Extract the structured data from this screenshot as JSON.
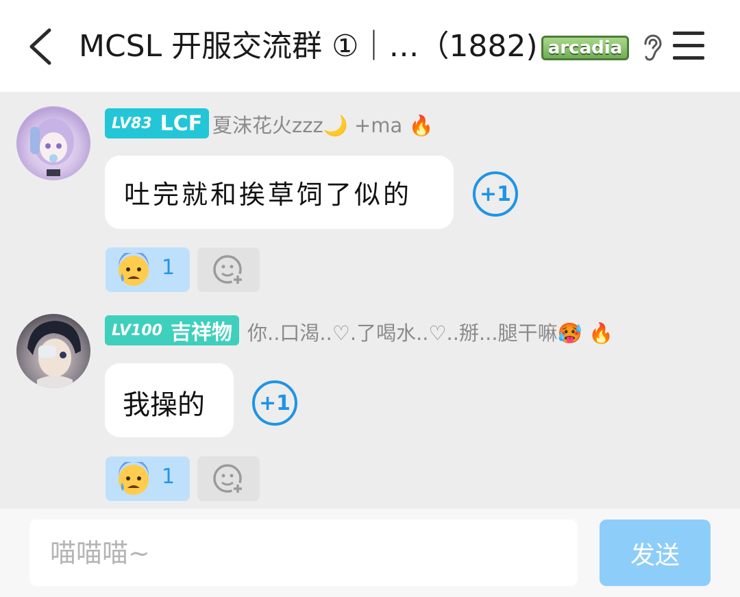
{
  "header": {
    "title": "MCSL 开服交流群 ①｜…（1882)",
    "badge_text": "arcadia",
    "back_icon": "back-chevron-icon",
    "ear_icon": "ear-icon",
    "menu_icon": "menu-icon"
  },
  "messages": [
    {
      "level": "LV83",
      "tag": "LCF",
      "nickname": "夏沫花火zzz🌙 +ma 🔥",
      "text": "吐完就和挨草饲了似的",
      "plus_one": "+1",
      "reaction_emoji": "anxious-sweat-face",
      "reaction_count": "1"
    },
    {
      "level": "LV100",
      "tag": "吉祥物",
      "nickname": "你..口渴..♡.了喝水..♡..掰...腿干嘛🥵 🔥",
      "text": "我操的",
      "plus_one": "+1",
      "reaction_emoji": "anxious-sweat-face",
      "reaction_count": "1"
    }
  ],
  "input": {
    "placeholder": "喵喵喵~",
    "send_label": "发送"
  },
  "colors": {
    "accent": "#1e94e6",
    "badge_lv83": "#23c6d6",
    "badge_lv100": "#3fcfbd",
    "send_button": "#8dcdfa",
    "reaction_bg": "#bfe0fb"
  }
}
